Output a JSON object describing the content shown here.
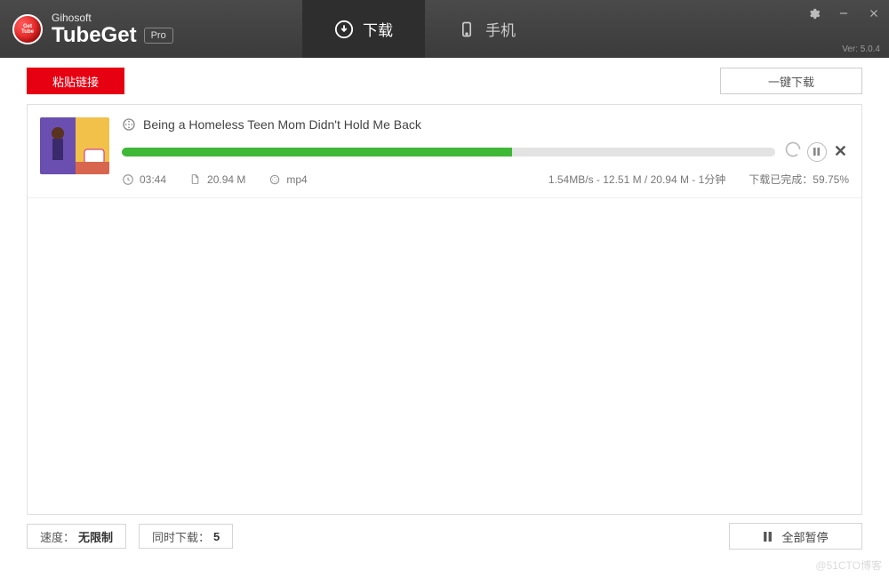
{
  "brand": {
    "company": "Gihosoft",
    "name": "TubeGet",
    "edition": "Pro",
    "version_label": "Ver: 5.0.4"
  },
  "tabs": {
    "download": {
      "label": "下载",
      "active": true
    },
    "mobile": {
      "label": "手机",
      "active": false
    }
  },
  "toolbar": {
    "paste_label": "粘贴链接",
    "onekey_label": "一键下载"
  },
  "downloads": [
    {
      "title": "Being a Homeless Teen Mom Didn't Hold Me Back",
      "duration": "03:44",
      "size": "20.94 M",
      "format": "mp4",
      "speed_line": "1.54MB/s - 12.51 M / 20.94 M - 1分钟",
      "status_line": "下载已完成：59.75%",
      "progress_percent": 59.75
    }
  ],
  "footer": {
    "speed_label": "速度：",
    "speed_value": "无限制",
    "concurrent_label": "同时下载：",
    "concurrent_value": "5",
    "pause_all_label": "全部暂停"
  },
  "watermark": "@51CTO博客"
}
